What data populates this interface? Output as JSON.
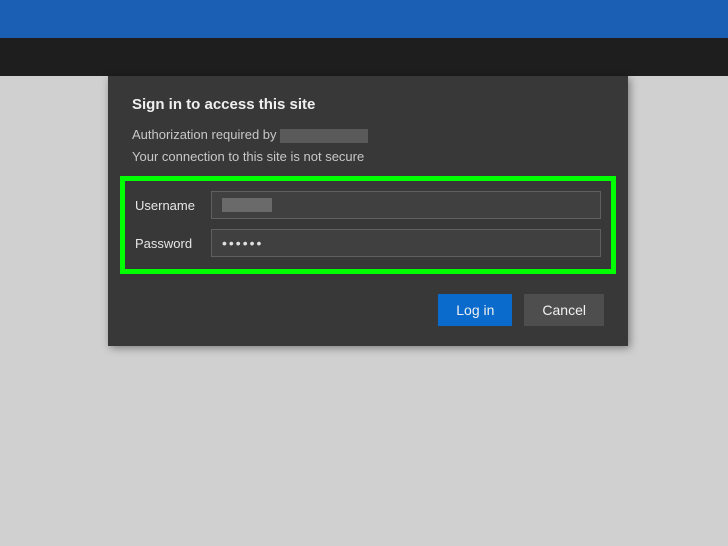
{
  "dialog": {
    "title": "Sign in to access this site",
    "auth_prefix": "Authorization required by",
    "warning": "Your connection to this site is not secure"
  },
  "fields": {
    "username_label": "Username",
    "password_label": "Password",
    "password_value": "••••••"
  },
  "buttons": {
    "login": "Log in",
    "cancel": "Cancel"
  }
}
